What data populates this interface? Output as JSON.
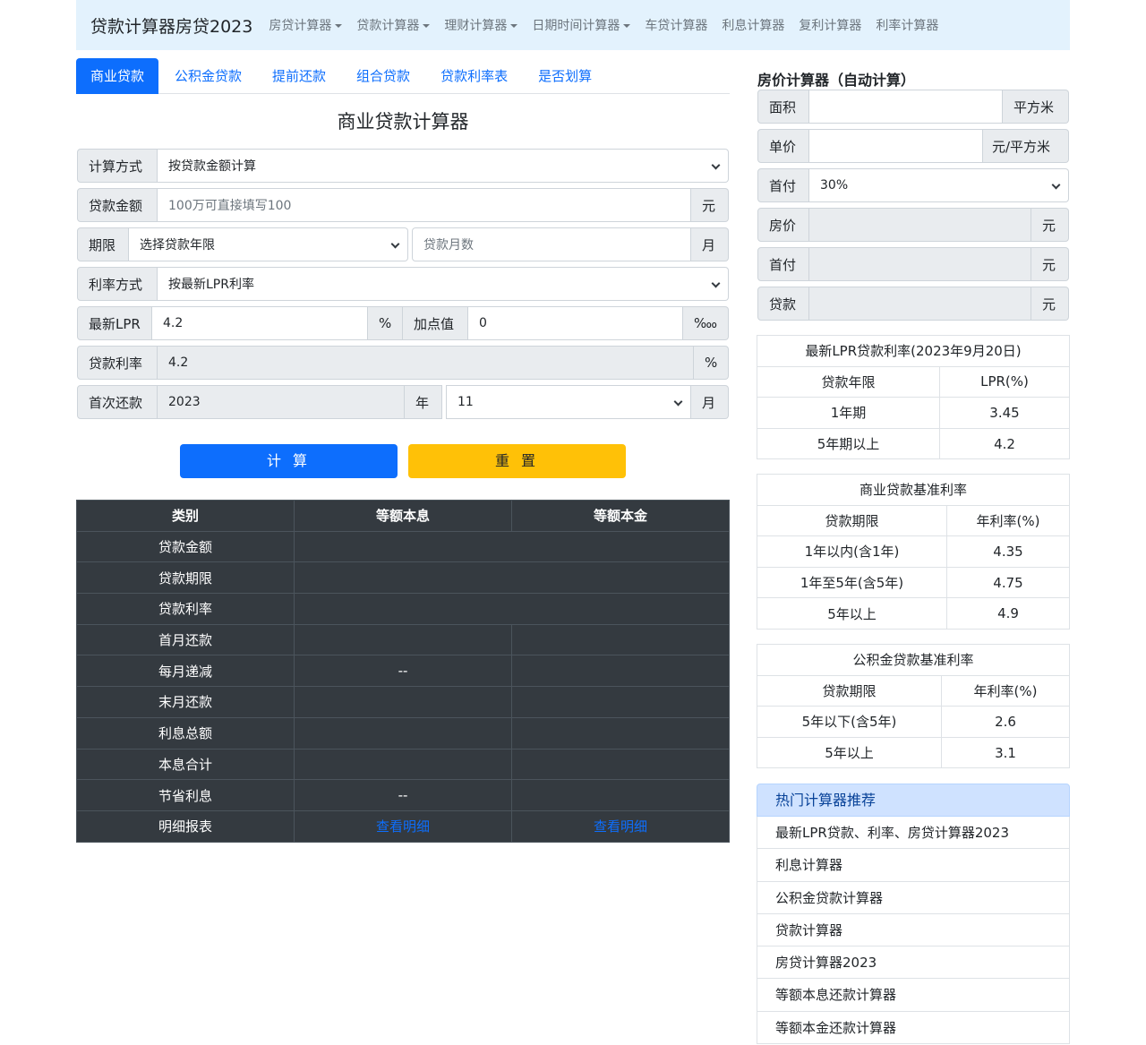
{
  "navbar": {
    "brand": "贷款计算器房贷2023",
    "items": [
      {
        "label": "房贷计算器",
        "dropdown": true
      },
      {
        "label": "贷款计算器",
        "dropdown": true
      },
      {
        "label": "理财计算器",
        "dropdown": true
      },
      {
        "label": "日期时间计算器",
        "dropdown": true
      },
      {
        "label": "车贷计算器",
        "dropdown": false
      },
      {
        "label": "利息计算器",
        "dropdown": false
      },
      {
        "label": "复利计算器",
        "dropdown": false
      },
      {
        "label": "利率计算器",
        "dropdown": false
      }
    ]
  },
  "tabs": [
    "商业贷款",
    "公积金贷款",
    "提前还款",
    "组合贷款",
    "贷款利率表",
    "是否划算"
  ],
  "active_tab": "商业贷款",
  "form": {
    "title": "商业贷款计算器",
    "calc_method": {
      "label": "计算方式",
      "value": "按贷款金额计算"
    },
    "loan_amount": {
      "label": "贷款金额",
      "placeholder": "100万可直接填写100",
      "unit": "元"
    },
    "term": {
      "label": "期限",
      "select_value": "选择贷款年限",
      "months_placeholder": "贷款月数",
      "unit": "月"
    },
    "rate_method": {
      "label": "利率方式",
      "value": "按最新LPR利率"
    },
    "lpr": {
      "label": "最新LPR",
      "value": "4.2",
      "unit": "%",
      "bp_label": "加点值",
      "bp_value": "0",
      "bp_unit": "‱"
    },
    "loan_rate": {
      "label": "贷款利率",
      "value": "4.2",
      "unit": "%"
    },
    "first_payment": {
      "label": "首次还款",
      "year": "2023",
      "year_unit": "年",
      "month": "11",
      "month_unit": "月"
    },
    "calc_button": "计 算",
    "reset_button": "重 置"
  },
  "results": {
    "headers": [
      "类别",
      "等额本息",
      "等额本金"
    ],
    "rows": [
      {
        "label": "贷款金额",
        "a": "",
        "b": "",
        "merged": true
      },
      {
        "label": "贷款期限",
        "a": "",
        "b": "",
        "merged": true
      },
      {
        "label": "贷款利率",
        "a": "",
        "b": "",
        "merged": true
      },
      {
        "label": "首月还款",
        "a": "",
        "b": ""
      },
      {
        "label": "每月递减",
        "a": "--",
        "b": ""
      },
      {
        "label": "末月还款",
        "a": "",
        "b": ""
      },
      {
        "label": "利息总额",
        "a": "",
        "b": ""
      },
      {
        "label": "本息合计",
        "a": "",
        "b": ""
      },
      {
        "label": "节省利息",
        "a": "--",
        "b": ""
      },
      {
        "label": "明细报表",
        "a": "查看明细",
        "b": "查看明细",
        "links": true
      }
    ]
  },
  "house_calc": {
    "title": "房价计算器（自动计算）",
    "area": {
      "label": "面积",
      "unit": "平方米"
    },
    "unit_price": {
      "label": "单价",
      "unit": "元/平方米"
    },
    "down_ratio": {
      "label": "首付",
      "value": "30%"
    },
    "price": {
      "label": "房价",
      "unit": "元"
    },
    "down_payment": {
      "label": "首付",
      "unit": "元"
    },
    "loan": {
      "label": "贷款",
      "unit": "元"
    }
  },
  "lpr_table": {
    "title": "最新LPR贷款利率(2023年9月20日)",
    "headers": [
      "贷款年限",
      "LPR(%)"
    ],
    "rows": [
      [
        "1年期",
        "3.45"
      ],
      [
        "5年期以上",
        "4.2"
      ]
    ]
  },
  "commercial_table": {
    "title": "商业贷款基准利率",
    "headers": [
      "贷款期限",
      "年利率(%)"
    ],
    "rows": [
      [
        "1年以内(含1年)",
        "4.35"
      ],
      [
        "1年至5年(含5年)",
        "4.75"
      ],
      [
        "5年以上",
        "4.9"
      ]
    ]
  },
  "fund_table": {
    "title": "公积金贷款基准利率",
    "headers": [
      "贷款期限",
      "年利率(%)"
    ],
    "rows": [
      [
        "5年以下(含5年)",
        "2.6"
      ],
      [
        "5年以上",
        "3.1"
      ]
    ]
  },
  "hot": {
    "title": "热门计算器推荐",
    "items": [
      "最新LPR贷款、利率、房贷计算器2023",
      "利息计算器",
      "公积金贷款计算器",
      "贷款计算器",
      "房贷计算器2023",
      "等额本息还款计算器",
      "等额本金还款计算器"
    ]
  }
}
